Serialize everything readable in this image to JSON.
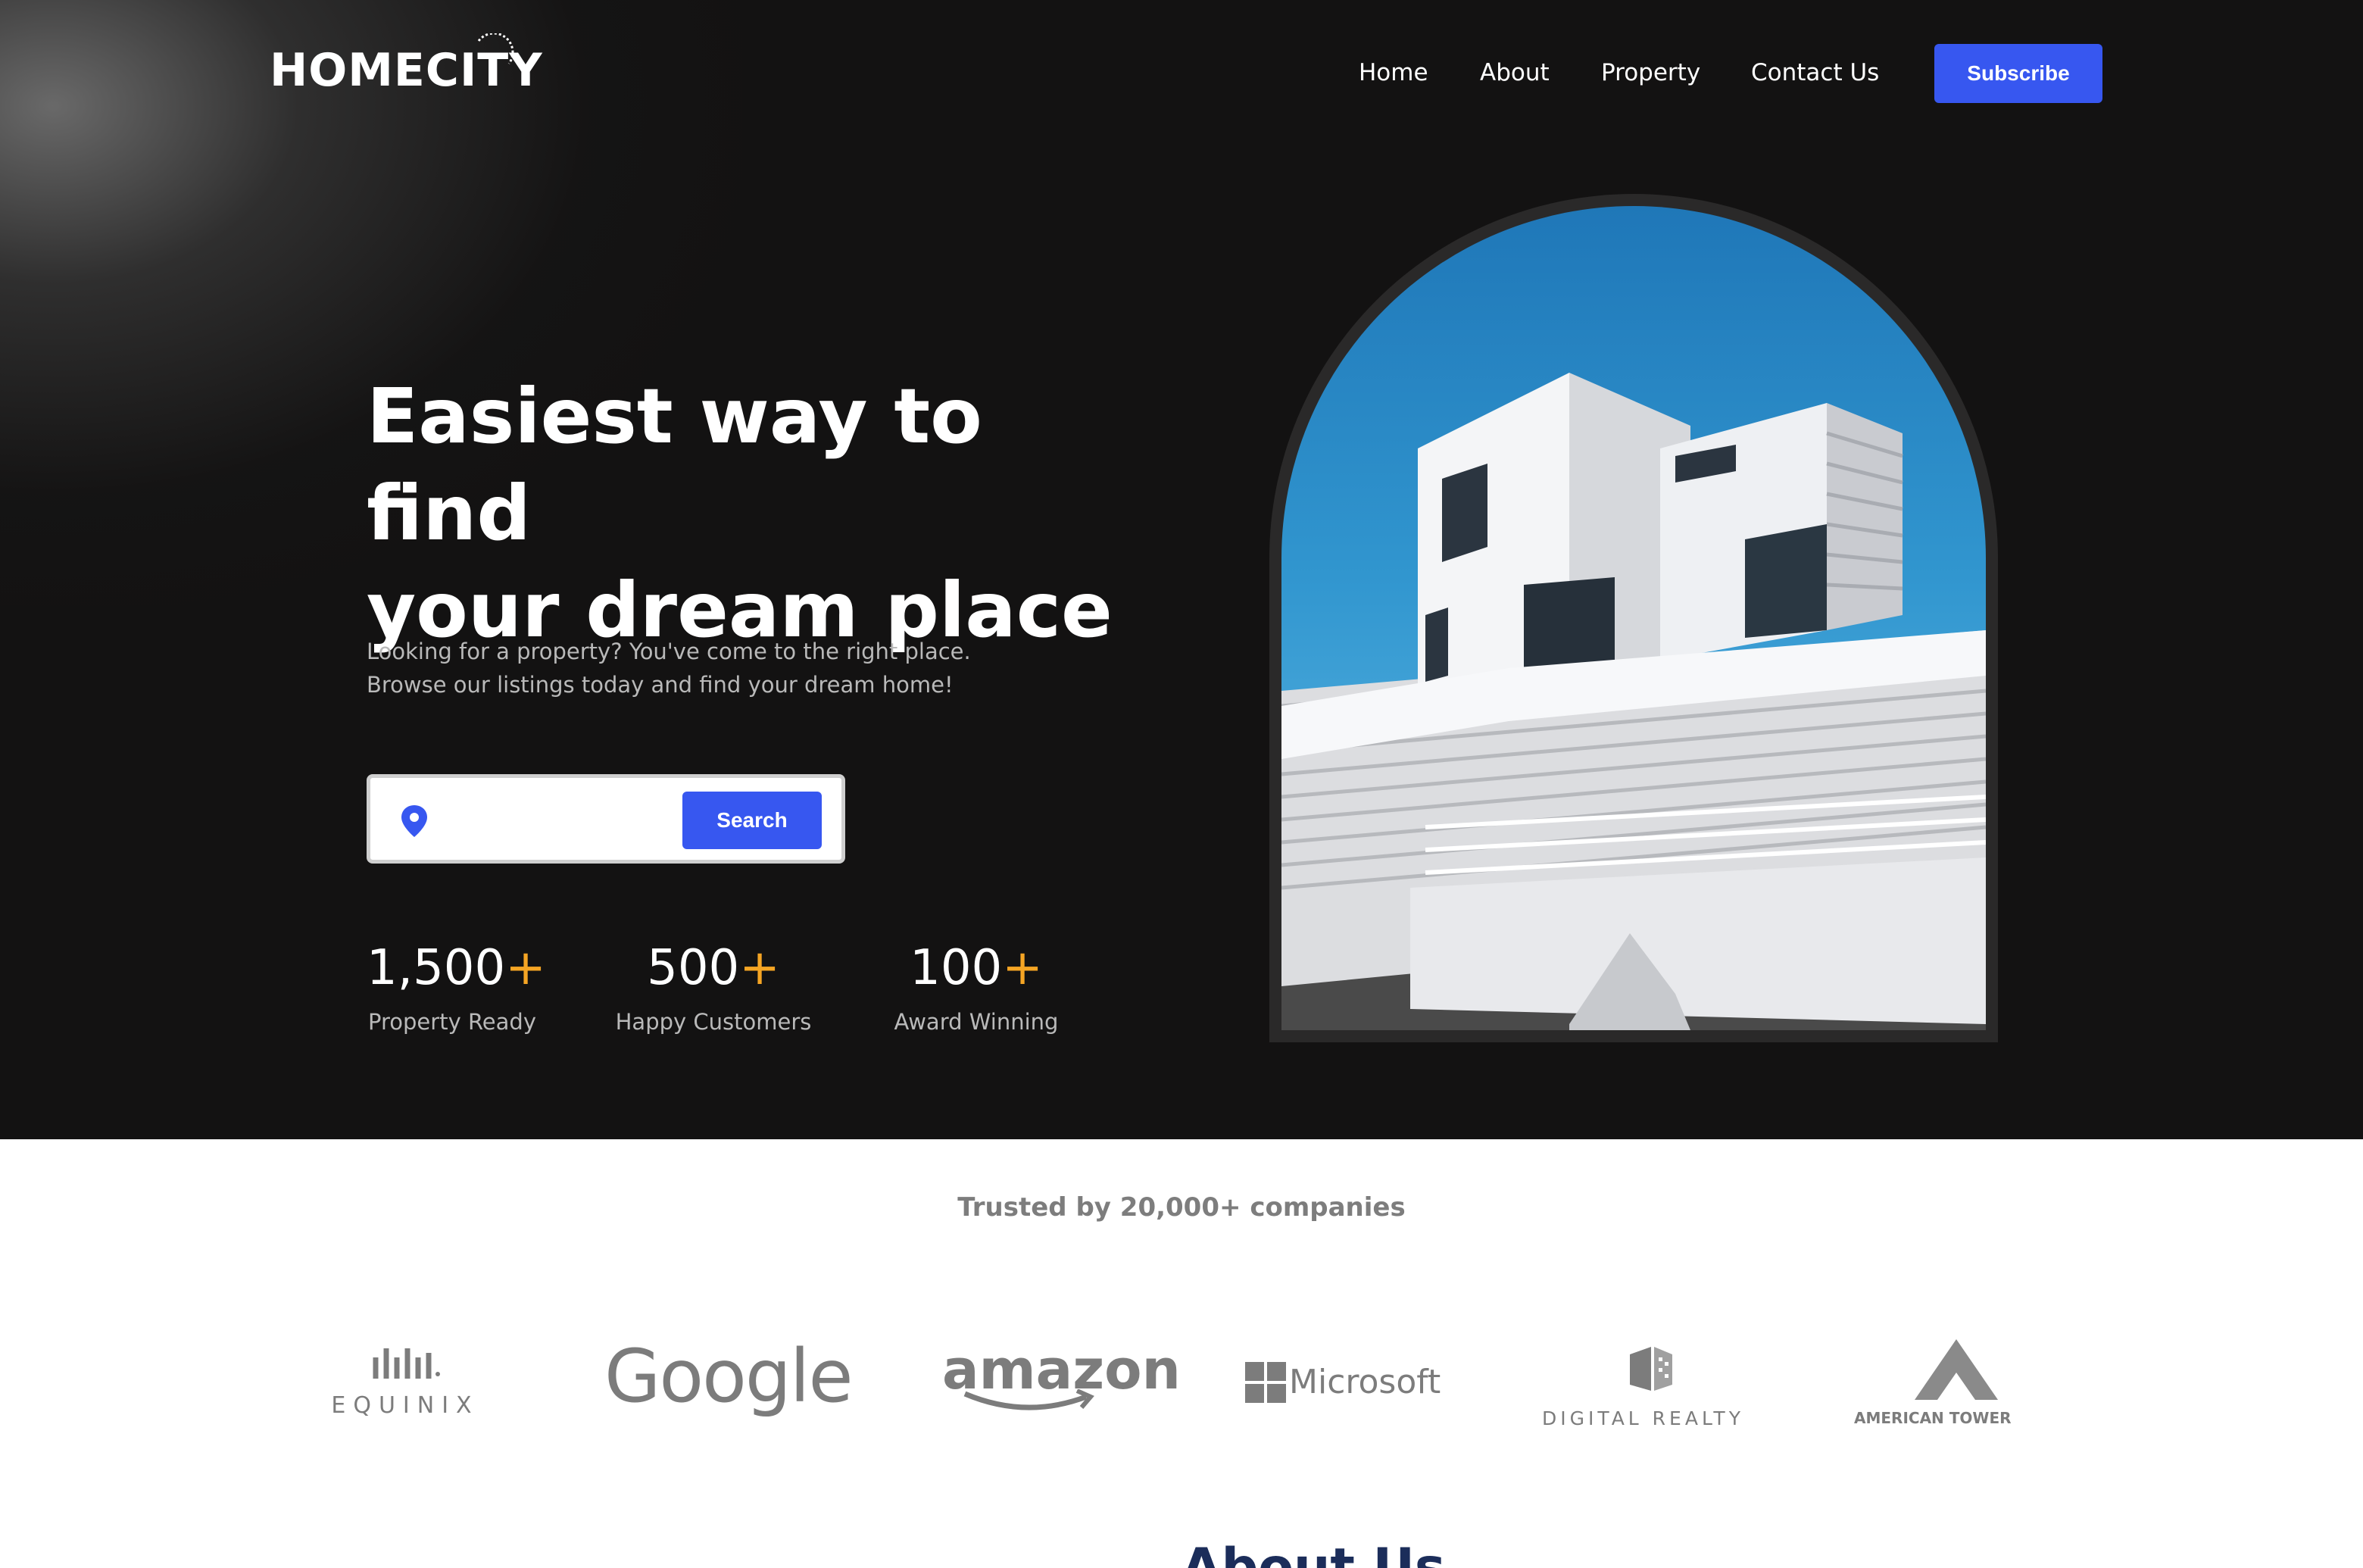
{
  "brand": {
    "logo_text": "HOMECITY",
    "accent": "#3757f0",
    "highlight": "#f5a524",
    "dark_bg": "#131212"
  },
  "nav": {
    "items": [
      "Home",
      "About",
      "Property",
      "Contact Us"
    ],
    "subscribe_label": "Subscribe"
  },
  "hero": {
    "headline_line1": "Easiest way to find",
    "headline_line2": "your dream place",
    "subtext_line1": "Looking for a property? You've come to the right place.",
    "subtext_line2": "Browse our listings today and find your dream home!",
    "search": {
      "placeholder": "",
      "button_label": "Search",
      "icon": "location-pin-icon"
    },
    "stats": [
      {
        "value": "1,500",
        "plus": "+",
        "label": "Property Ready"
      },
      {
        "value": "500",
        "plus": "+",
        "label": "Happy Customers"
      },
      {
        "value": "100",
        "plus": "+",
        "label": "Award Winning"
      }
    ]
  },
  "trusted": {
    "title": "Trusted by 20,000+ companies",
    "companies": [
      "EQUINIX",
      "Google",
      "amazon",
      "Microsoft",
      "DIGITAL REALTY",
      "AMERICAN TOWER"
    ]
  },
  "about": {
    "title": "About Us"
  }
}
